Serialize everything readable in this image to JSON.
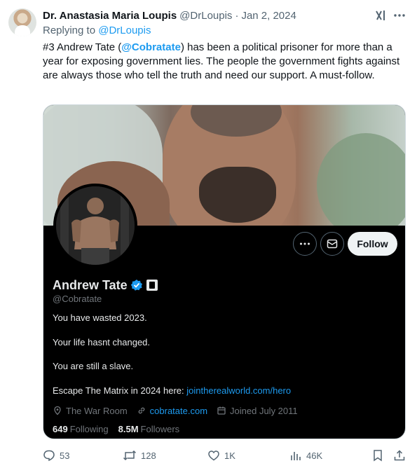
{
  "post": {
    "author_name": "Dr. Anastasia Maria Loupis",
    "author_handle": "@DrLoupis",
    "separator": "·",
    "date": "Jan 2, 2024",
    "replying_to_prefix": "Replying to",
    "replying_to_handle": "@DrLoupis",
    "text_before_mention": "#3 Andrew Tate (",
    "mention": "@Cobratate",
    "text_after_mention": ") has been a political prisoner for more than a year for exposing government lies. The people the government fights against are always those who tell the truth and need our support. A must-follow."
  },
  "profile_card": {
    "name": "Andrew Tate",
    "handle": "@Cobratate",
    "follow_label": "Follow",
    "bio": [
      "You have wasted 2023.",
      "Your life hasnt changed.",
      "You are still a slave."
    ],
    "bio_link_prefix": "Escape The Matrix in 2024 here: ",
    "bio_link": "jointherealworld.com/hero",
    "location": "The War Room",
    "website": "cobratate.com",
    "joined": "Joined July 2011",
    "following_count": "649",
    "following_label": "Following",
    "followers_count": "8.5M",
    "followers_label": "Followers"
  },
  "engagement": {
    "replies": "53",
    "reposts": "128",
    "likes": "1K",
    "views": "46K"
  },
  "colors": {
    "accent": "#1d9bf0",
    "text_primary": "#0f1419",
    "text_secondary": "#536471",
    "card_background": "#000000",
    "card_text": "#e7e9ea"
  },
  "icons": [
    "grok-icon",
    "more-horizontal-icon",
    "verified-badge-icon",
    "affiliate-badge-icon",
    "message-icon",
    "location-icon",
    "link-icon",
    "calendar-icon",
    "reply-icon",
    "repost-icon",
    "like-icon",
    "views-icon",
    "bookmark-icon",
    "share-icon"
  ]
}
